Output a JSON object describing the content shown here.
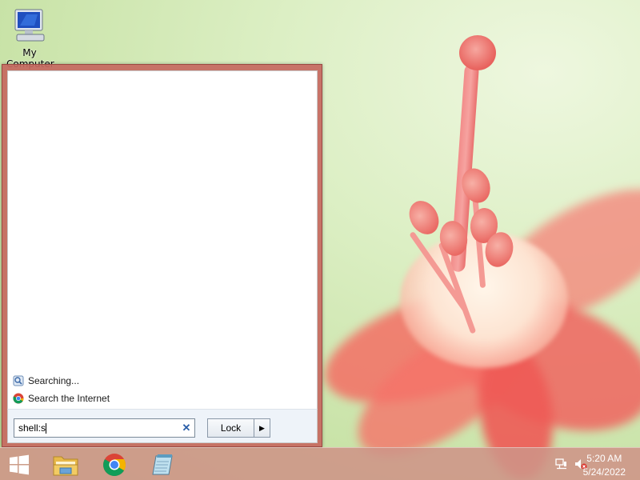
{
  "desktop": {
    "icons": [
      {
        "label": "My Computer"
      }
    ]
  },
  "start_menu": {
    "results": [
      {
        "icon": "searching-icon",
        "label": "Searching..."
      },
      {
        "icon": "chrome-icon",
        "label": "Search the Internet"
      }
    ],
    "search": {
      "value": "shell:s",
      "clear_symbol": "✕"
    },
    "power_button": {
      "label": "Lock",
      "arrow": "▶"
    }
  },
  "taskbar": {
    "start_icon": "windows-logo-icon",
    "pinned": [
      {
        "icon": "file-explorer-icon"
      },
      {
        "icon": "chrome-icon"
      },
      {
        "icon": "notepad-icon"
      }
    ],
    "tray": {
      "network_icon": "network-icon",
      "volume_icon": "volume-muted-icon",
      "time": "5:20 AM",
      "date": "5/24/2022"
    }
  },
  "colors": {
    "start_menu_frame": "#c66860",
    "taskbar": "#ce9487",
    "wallpaper_green": "#c9e3a8",
    "flower": "#f06e64"
  }
}
